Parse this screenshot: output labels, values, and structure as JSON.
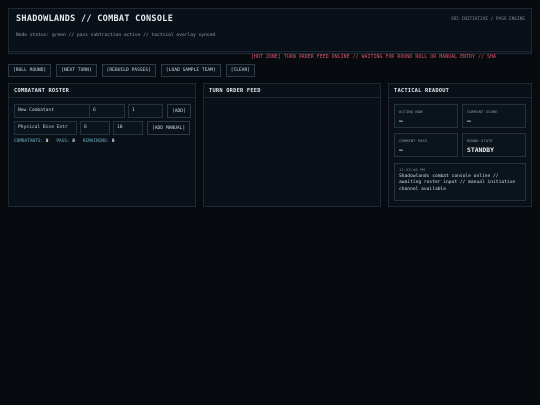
{
  "header": {
    "title": "SHADOWLANDS // COMBAT CONSOLE",
    "subtitle": "SR5 INITIATIVE / PASS ENGINE",
    "status": "Node status: green // pass subtraction active // tactical overlay synced",
    "ticker": "[HOT ZONE] TURN ORDER FEED ONLINE // WAITING FOR ROUND ROLL OR MANUAL ENTRY // SHA"
  },
  "toolbar": {
    "roll_round": "[ROLL ROUND]",
    "next_turn": "[NEXT TURN]",
    "rebuild_passes": "[REBUILD PASSES]",
    "load_sample": "[LOAD SAMPLE TEAM]",
    "clear": "[CLEAR]"
  },
  "roster": {
    "heading": "COMBATANT ROSTER",
    "name_value": "New Combatant",
    "init_value": "6",
    "dice_value": "1",
    "add_label": "[ADD]",
    "manual_name_value": "Physical Dice Entr",
    "manual_init_value": "6",
    "manual_dice_value": "10",
    "add_manual_label": "[ADD MANUAL]",
    "stats": {
      "combatants_label": "COMBATANTS:",
      "combatants": "0",
      "pass_label": "PASS:",
      "pass": "0",
      "remaining_label": "REMAINING:",
      "remaining": "0"
    }
  },
  "feed": {
    "heading": "TURN ORDER FEED"
  },
  "readout": {
    "heading": "TACTICAL READOUT",
    "acting_label": "ACTING NOW",
    "acting_value": "—",
    "score_label": "CURRENT SCORE",
    "score_value": "—",
    "pass_label": "CURRENT PASS",
    "pass_value": "—",
    "state_label": "ROUND STATE",
    "state_value": "STANDBY",
    "log_time": "11:23:46 PM",
    "log_text": "Shadowlands combat console online // awaiting roster input // manual initiative channel available"
  }
}
